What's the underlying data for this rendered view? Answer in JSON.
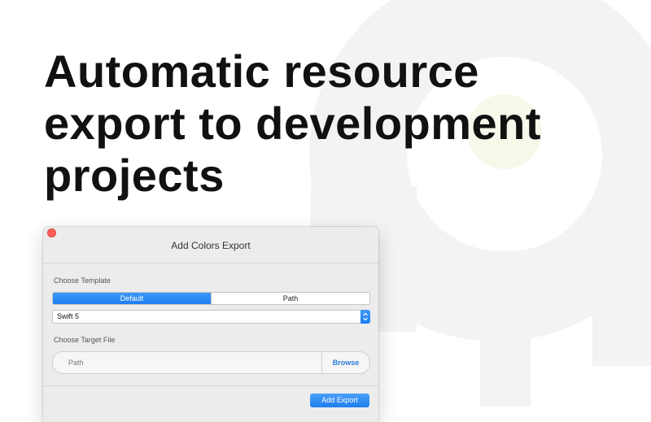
{
  "headline": {
    "lines": [
      "Automatic resource",
      "export to development",
      "projects"
    ]
  },
  "dialog": {
    "title": "Add Colors Export",
    "template_section": {
      "label": "Choose Template",
      "segments": [
        {
          "label": "Default",
          "selected": true
        },
        {
          "label": "Path",
          "selected": false
        }
      ],
      "popup_value": "Swift 5"
    },
    "target_section": {
      "label": "Choose Target File",
      "path_placeholder": "Path",
      "browse_label": "Browse"
    },
    "primary_button_label": "Add Export"
  },
  "colors": {
    "accent": "#1d7ef0",
    "close_dot": "#ff5f57",
    "background_art": "#f3f3f3",
    "art_highlight": "#f4f9ea"
  },
  "icons": {
    "close": "close-dot-icon",
    "stepper": "chevron-updown-icon",
    "background": "key-logo-art"
  }
}
